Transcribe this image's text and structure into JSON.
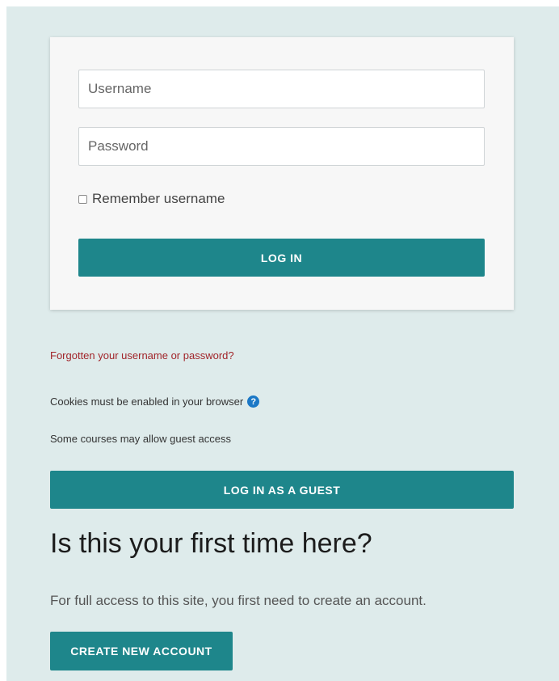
{
  "login_form": {
    "username_placeholder": "Username",
    "username_value": "",
    "password_placeholder": "Password",
    "password_value": "",
    "remember_label": "Remember username",
    "remember_checked": false,
    "login_button_label": "LOG IN"
  },
  "links": {
    "forgot_label": "Forgotten your username or password?"
  },
  "cookies": {
    "text": "Cookies must be enabled in your browser",
    "help_icon": "?"
  },
  "guest": {
    "text": "Some courses may allow guest access",
    "button_label": "LOG IN AS A GUEST"
  },
  "signup": {
    "heading": "Is this your first time here?",
    "description": "For full access to this site, you first need to create an account.",
    "button_label": "CREATE NEW ACCOUNT"
  },
  "colors": {
    "page_background": "#deebeb",
    "card_background": "#f7f7f7",
    "primary_button": "#1e868b",
    "link": "#a1252a",
    "help_icon": "#1b78c6"
  }
}
